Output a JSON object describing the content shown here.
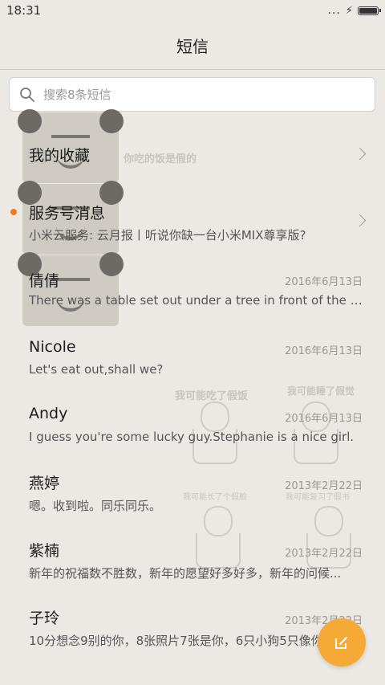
{
  "status_bar": {
    "time": "18:31",
    "signal_dots": "...",
    "charging_glyph": "⚡"
  },
  "title_bar": {
    "title": "短信"
  },
  "search": {
    "placeholder": "搜索8条短信"
  },
  "decor_texts": {
    "t1": "你吃的饭是假的",
    "t2": "我可能吃了假饭",
    "t3": "我可能睡了假觉",
    "t4": "我可能长了个假脸",
    "t5": "我可能复习了假书"
  },
  "conversations": [
    {
      "name": "我的收藏",
      "preview": "",
      "date": "",
      "chevron": true,
      "unread": false
    },
    {
      "name": "服务号消息",
      "preview": "小米云服务: 云月报丨听说你缺一台小米MIX尊享版?",
      "date": "",
      "chevron": true,
      "unread": true
    },
    {
      "name": "倩倩",
      "preview": "There was a table set out under a tree in front of the ho...",
      "date": "2016年6月13日",
      "chevron": false,
      "unread": false
    },
    {
      "name": "Nicole",
      "preview": "Let's eat out,shall we?",
      "date": "2016年6月13日",
      "chevron": false,
      "unread": false
    },
    {
      "name": "Andy",
      "preview": "I guess you're some lucky guy.Stephanie is a nice girl.",
      "date": "2016年6月13日",
      "chevron": false,
      "unread": false
    },
    {
      "name": "燕婷",
      "preview": "嗯。收到啦。同乐同乐。",
      "date": "2013年2月22日",
      "chevron": false,
      "unread": false
    },
    {
      "name": "紫楠",
      "preview": "新年的祝福数不胜数，新年的愿望好多好多，新年的问候...",
      "date": "2013年2月22日",
      "chevron": false,
      "unread": false
    },
    {
      "name": "子玲",
      "preview": "10分想念9别的你，8张照片7张是你，6只小狗5只像你",
      "date": "2013年2月22日",
      "chevron": false,
      "unread": false
    }
  ],
  "fab": {
    "icon": "compose-icon"
  },
  "colors": {
    "accent": "#f6a935",
    "unread_dot": "#f07c1e",
    "background": "#ece9e4"
  }
}
